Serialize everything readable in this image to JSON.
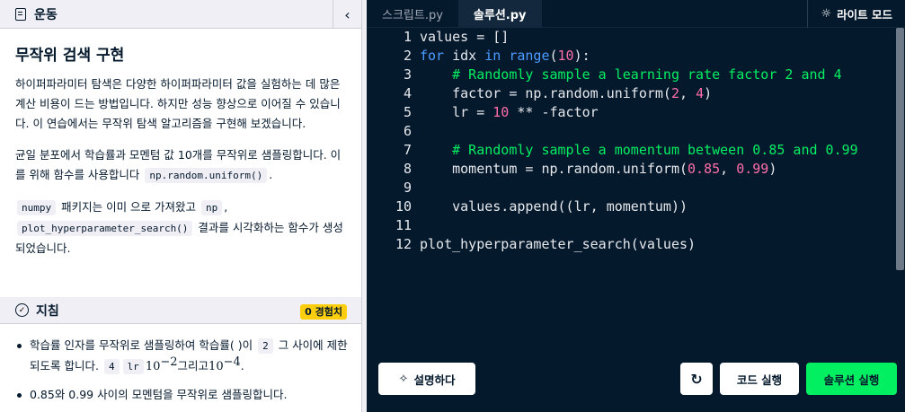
{
  "left": {
    "header_title": "운동",
    "collapse_glyph": "‹",
    "title": "무작위 검색 구현",
    "para1": "하이퍼파라미터 탐색은 다양한 하이퍼파라미터 값을 실험하는 데 많은 계산 비용이 드는 방법입니다. 하지만 성능 향상으로 이어질 수 있습니다. 이 연습에서는 무작위 탐색 알고리즘을 구현해 보겠습니다.",
    "para2_a": "균일 분포에서 학습률과 모멘텀 값 10개를 무작위로 샘플링합니다. 이를 위해 함수를 사용합니다",
    "para2_code": "np.random.uniform()",
    "para2_b": ".",
    "para3_code1": "numpy",
    "para3_a": " 패키지는 이미 으로 가져왔고",
    "para3_code2": "np",
    "para3_b": ",",
    "para3_code3": "plot_hyperparameter_search()",
    "para3_c": " 결과를 시각화하는 함수가 생성되었습니다."
  },
  "guide": {
    "title": "지침",
    "xp_badge": "0 경험치",
    "item1_a": "학습률 인자를 무작위로 샘플링하여 학습률( )이",
    "item1_code1": "2",
    "item1_b": " 그 사이에 제한되도록 합니다.",
    "item1_code2": "4",
    "item1_code3": "lr",
    "item1_m1": "10",
    "item1_sup1": "−2",
    "item1_c": "그리고",
    "item1_m2": "10",
    "item1_sup2": "−4",
    "item1_d": ".",
    "item2": "0.85와 0.99 사이의 모멘텀을 무작위로 샘플링합니다."
  },
  "editor": {
    "tab_script": "스크립트.py",
    "tab_solution": "솔루션.py",
    "light_mode": "라이트 모드",
    "line_numbers": [
      "1",
      "2",
      "3",
      "4",
      "5",
      "6",
      "7",
      "8",
      "9",
      "10",
      "11",
      "12"
    ],
    "lines": [
      "values = []",
      "for idx in range(10):",
      "    # Randomly sample a learning rate factor 2 and 4",
      "    factor = np.random.uniform(2, 4)",
      "    lr = 10 ** -factor",
      "",
      "    # Randomly sample a momentum between 0.85 and 0.99",
      "    momentum = np.random.uniform(0.85, 0.99)",
      "",
      "    values.append((lr, momentum))",
      "",
      "plot_hyperparameter_search(values)"
    ]
  },
  "buttons": {
    "explain": "설명하다",
    "reset_glyph": "↻",
    "run_code": "코드 실행",
    "run_solution": "솔루션 실행"
  },
  "colors": {
    "navy": "#05192d",
    "green": "#03ef62",
    "keyword": "#4b9cff",
    "number": "#ff6ea9",
    "xp_yellow": "#fcce0d"
  },
  "icons": [
    "document-icon",
    "chevron-left-icon",
    "check-circle-icon",
    "sun-icon",
    "sparkle-icon",
    "reset-icon"
  ]
}
